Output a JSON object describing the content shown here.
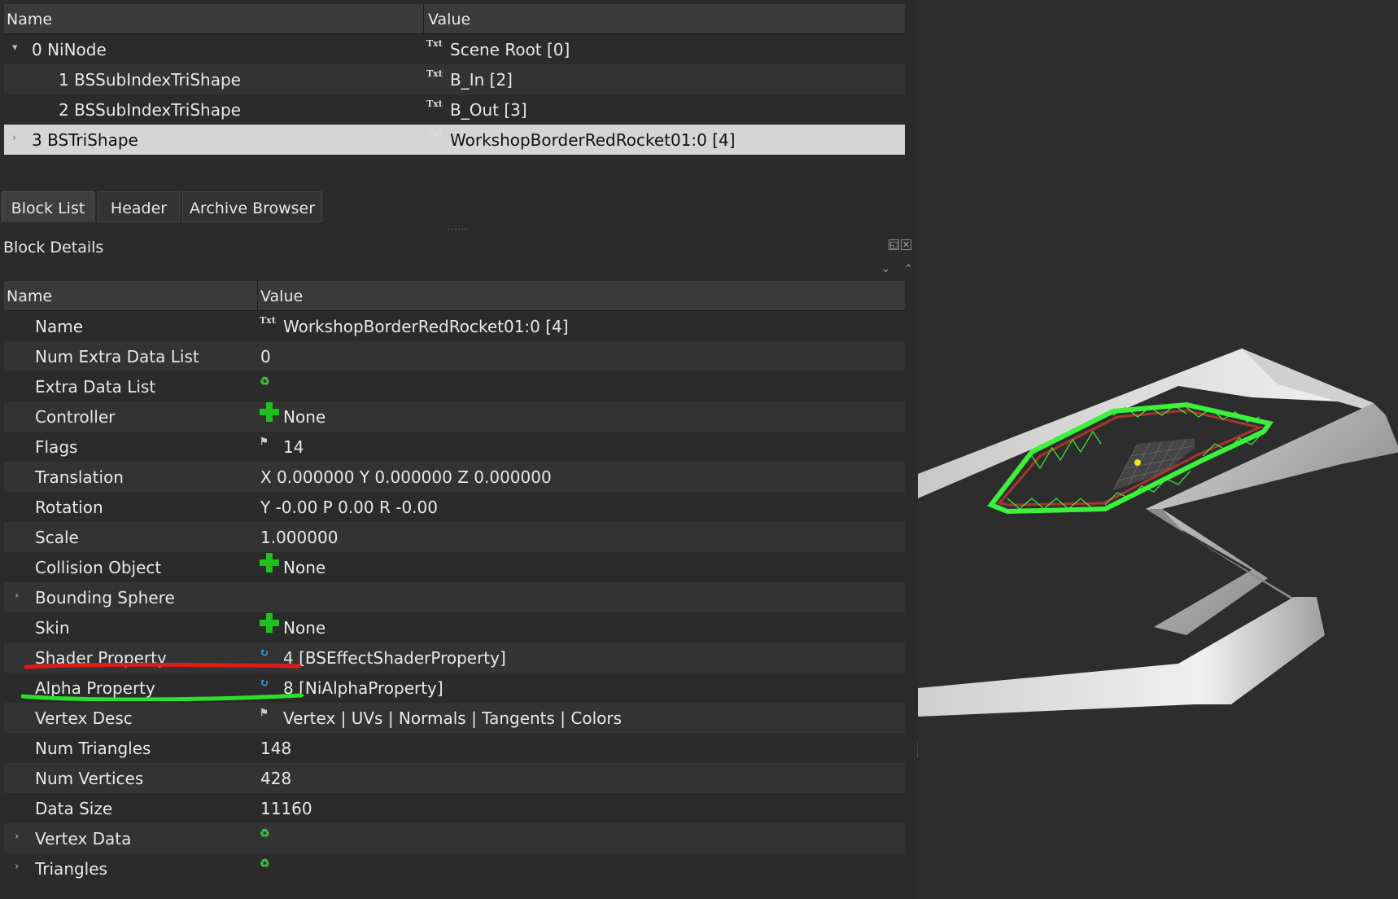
{
  "tree": {
    "headers": {
      "name": "Name",
      "value": "Value"
    },
    "rows": [
      {
        "name": "0 NiNode",
        "value": "Scene Root [0]",
        "icon": "txt-icon",
        "expander": "▾",
        "indent": 0
      },
      {
        "name": "1 BSSubIndexTriShape",
        "value": "B_In [2]",
        "icon": "txt-icon",
        "expander": "",
        "indent": 1
      },
      {
        "name": "2 BSSubIndexTriShape",
        "value": "B_Out [3]",
        "icon": "txt-icon",
        "expander": "",
        "indent": 1
      },
      {
        "name": "3 BSTriShape",
        "value": "WorkshopBorderRedRocket01:0 [4]",
        "icon": "txt-icon",
        "expander": "›",
        "indent": 0,
        "selected": true
      }
    ]
  },
  "tabs": [
    "Block List",
    "Header",
    "Archive Browser"
  ],
  "dock": {
    "title": "Block Details"
  },
  "details": {
    "headers": {
      "name": "Name",
      "value": "Value"
    },
    "rows": [
      {
        "name": "Name",
        "icon": "txt-icon",
        "value": "WorkshopBorderRedRocket01:0 [4]"
      },
      {
        "name": "Num Extra Data List",
        "icon": "",
        "value": "0"
      },
      {
        "name": "Extra Data List",
        "icon": "loop-icon",
        "value": ""
      },
      {
        "name": "Controller",
        "icon": "plus-icon",
        "value": "None"
      },
      {
        "name": "Flags",
        "icon": "flag-icon",
        "value": "14"
      },
      {
        "name": "Translation",
        "icon": "",
        "value": "X 0.000000 Y 0.000000 Z 0.000000"
      },
      {
        "name": "Rotation",
        "icon": "",
        "value": "Y -0.00 P 0.00 R -0.00"
      },
      {
        "name": "Scale",
        "icon": "",
        "value": "1.000000"
      },
      {
        "name": "Collision Object",
        "icon": "plus-icon",
        "value": "None"
      },
      {
        "name": "Bounding Sphere",
        "icon": "",
        "value": "",
        "expander": "›"
      },
      {
        "name": "Skin",
        "icon": "plus-icon",
        "value": "None"
      },
      {
        "name": "Shader Property",
        "icon": "link-icon",
        "value": "4 [BSEffectShaderProperty]"
      },
      {
        "name": "Alpha Property",
        "icon": "link-icon",
        "value": "8 [NiAlphaProperty]"
      },
      {
        "name": "Vertex Desc",
        "icon": "flag-icon",
        "value": "Vertex | UVs | Normals | Tangents | Colors"
      },
      {
        "name": "Num Triangles",
        "icon": "",
        "value": "148"
      },
      {
        "name": "Num Vertices",
        "icon": "",
        "value": "428"
      },
      {
        "name": "Data Size",
        "icon": "",
        "value": "11160"
      },
      {
        "name": "Vertex Data",
        "icon": "loop-icon",
        "value": "",
        "expander": "›"
      },
      {
        "name": "Triangles",
        "icon": "loop-icon",
        "value": "",
        "expander": "›"
      }
    ]
  },
  "icons": {
    "txt": "Txt"
  },
  "colors": {
    "background": "#2b2b2b",
    "row_alt": "#333333",
    "selected_row": "#d5d5d5",
    "annotation_red": "#e01b1b",
    "annotation_green": "#2be02b",
    "mesh_green": "#3cf03c",
    "border_white": "#e0e0e0"
  }
}
